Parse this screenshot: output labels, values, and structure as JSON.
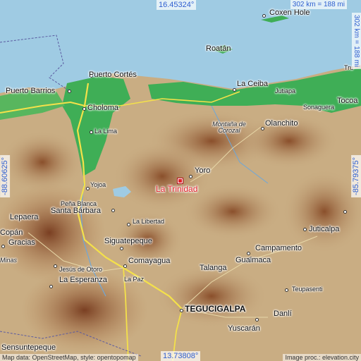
{
  "map": {
    "colors": {
      "sea": "#9fcbe3",
      "lowland": "#3fae56",
      "terrain": "#c9ad83",
      "mountain": "#9b5f35",
      "road": "#f4e14a",
      "target": "#e0242c",
      "coord": "#2f5fd0"
    },
    "coords": {
      "top": "16.45324°",
      "bottom": "13.73808°",
      "left": "-88.60625°",
      "right": "-85.79375°"
    },
    "scale": {
      "top": "302 km = 188 mi",
      "right": "302 km = 188 mi"
    },
    "target": "La Trinidad",
    "places": {
      "coxen_hole": "Coxen Hole",
      "roatan": "Roatán",
      "puerto_cortes": "Puerto Cortés",
      "puerto_barrios": "Puerto Barrios",
      "choloma": "Choloma",
      "la_lima": "La Lima",
      "la_ceiba": "La Ceiba",
      "jutiapa": "Jutiapa",
      "sonaguera": "Sonaguera",
      "tocoa": "Tocoa",
      "truj": "Tru",
      "montana_corozal": "Montaña de Corozal",
      "olanchito": "Olanchito",
      "yoro": "Yoro",
      "yojoa": "Yojoa",
      "pena_blanca": "Peña Blanca",
      "santa_barbara": "Santa Bárbara",
      "la_libertad": "La Libertad",
      "lepaera": "Lepaera",
      "copan": "Copán",
      "gracias": "Gracias",
      "minas": "Minas",
      "siguatepeque": "Siguatepeque",
      "jesus_otoro": "Jesús de Otoro",
      "comayagua": "Comayagua",
      "la_esperanza": "La Esperanza",
      "la_paz": "La Paz",
      "campamento": "Campamento",
      "juticalpa": "Juticalpa",
      "guaimaca": "Guaimaca",
      "talanga": "Talanga",
      "teupasenti": "Teupasenti",
      "tegucigalpa": "TEGUCIGALPA",
      "danli": "Danlí",
      "yuscaran": "Yuscarán",
      "sensuntepeque": "Sensuntepeque"
    },
    "attribution_left": "Map data: OpenStreetMap, style: opentopomap",
    "attribution_right": "Image proc.: elevation.city"
  }
}
